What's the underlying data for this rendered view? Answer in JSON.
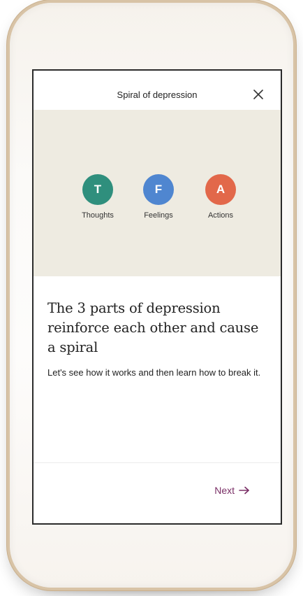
{
  "header": {
    "title": "Spiral of depression"
  },
  "hero": {
    "nodes": [
      {
        "letter": "T",
        "label": "Thoughts",
        "color": "#2f8f7d"
      },
      {
        "letter": "F",
        "label": "Feelings",
        "color": "#4f86d0"
      },
      {
        "letter": "A",
        "label": "Actions",
        "color": "#e2684a"
      }
    ]
  },
  "content": {
    "headline": "The 3 parts of depression reinforce each other and cause a spiral",
    "subtext": "Let's see how it works and then learn how to break it."
  },
  "footer": {
    "next_label": "Next"
  },
  "icons": {
    "close": "close-icon",
    "next": "arrow-right-icon"
  },
  "colors": {
    "accent": "#7a2f66",
    "hero_background": "#eeebe1"
  }
}
